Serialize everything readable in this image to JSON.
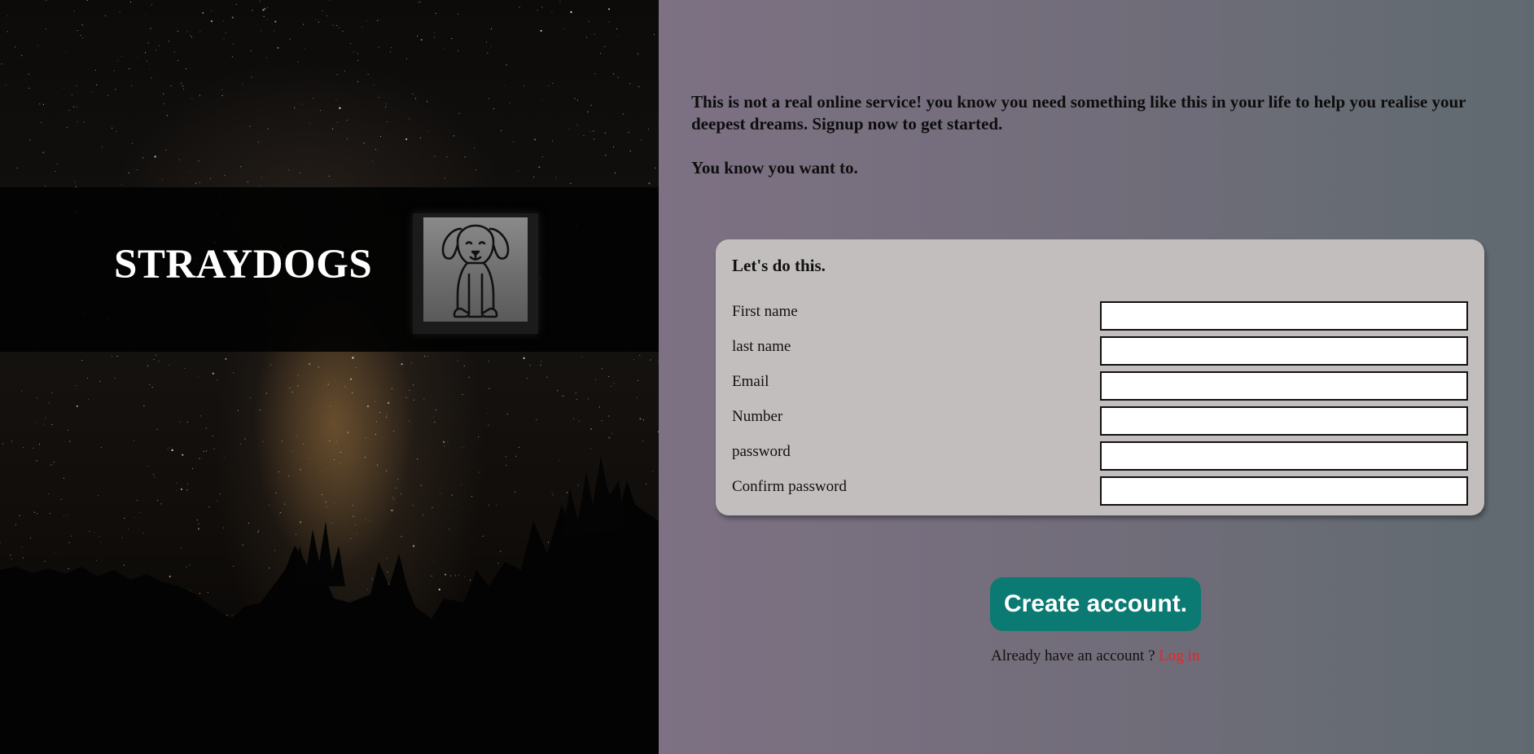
{
  "brand": {
    "name": "STRAYDOGS",
    "logo_icon": "sitting-dog-icon"
  },
  "intro": {
    "paragraph1": "This is not a real online service! you know you need something like this in your life to help you realise your deepest dreams. Signup now to get started.",
    "paragraph2": "You know you want to."
  },
  "form": {
    "title": "Let's do this.",
    "fields": [
      {
        "label": "First name",
        "value": ""
      },
      {
        "label": "last name",
        "value": ""
      },
      {
        "label": "Email",
        "value": ""
      },
      {
        "label": "Number",
        "value": ""
      },
      {
        "label": "password",
        "value": ""
      },
      {
        "label": "Confirm password",
        "value": ""
      }
    ]
  },
  "actions": {
    "create_label": "Create account.",
    "login_prompt": "Already have an account ?",
    "login_link": "Log in"
  },
  "colors": {
    "button": "#0a7a72",
    "link": "#ff1a1a",
    "card": "#c2bebd"
  }
}
